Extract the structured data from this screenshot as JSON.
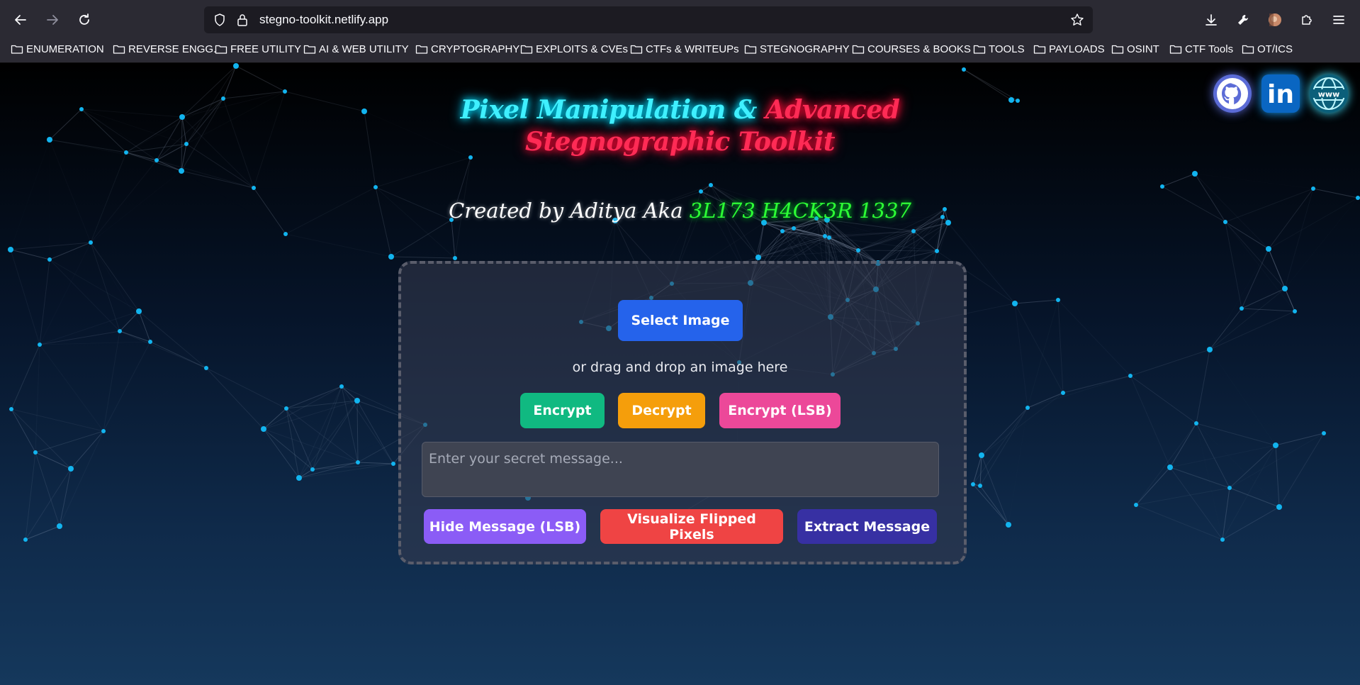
{
  "browser": {
    "url": "stegno-toolkit.netlify.app",
    "bookmarks": [
      "ENUMERATION",
      "REVERSE ENGG.",
      "FREE UTILITY",
      "AI & WEB UTILITY",
      "CRYPTOGRAPHY",
      "EXPLOITS & CVEs",
      "CTFs & WRITEUPs",
      "STEGNOGRAPHY",
      "COURSES & BOOKS",
      "TOOLS",
      "PAYLOADS",
      "OSINT",
      "CTF Tools",
      "OT/ICS"
    ]
  },
  "header": {
    "title_part1": "Pixel Manipulation &",
    "title_part2": "Advanced",
    "title_line2": "Stegnographic Toolkit",
    "created_by": "Created by Aditya Aka",
    "handle": "3L173 H4CK3R 1337"
  },
  "social": {
    "icons": [
      "github-icon",
      "linkedin-icon",
      "website-icon"
    ],
    "linkedin_text": "in",
    "www_text": "www"
  },
  "toolkit": {
    "select_label": "Select Image",
    "drag_text": "or drag and drop an image here",
    "encrypt_label": "Encrypt",
    "decrypt_label": "Decrypt",
    "encrypt_lsb_label": "Encrypt (LSB)",
    "message_placeholder": "Enter your secret message...",
    "hide_label": "Hide Message (LSB)",
    "visualize_label": "Visualize Flipped Pixels",
    "extract_label": "Extract Message"
  },
  "colors": {
    "select": "#2563eb",
    "encrypt": "#10b981",
    "decrypt": "#f59e0b",
    "encrypt_lsb": "#ec4899",
    "hide": "#8b5cf6",
    "visualize": "#ef4444",
    "extract": "#3730a3",
    "title_cyan": "#3ff0ff",
    "title_red": "#ff2b55",
    "handle_green": "#2dff35"
  }
}
